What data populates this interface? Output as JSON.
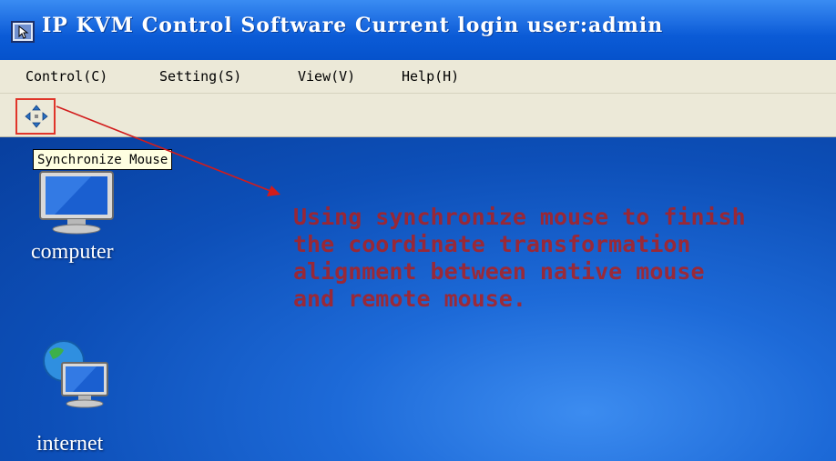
{
  "window": {
    "title": "IP KVM Control Software Current login user:admin"
  },
  "menu": {
    "items": [
      "Control(C)",
      "Setting(S)",
      "View(V)",
      "Help(H)"
    ]
  },
  "toolbar": {
    "sync_icon": "move-arrows-icon"
  },
  "tooltip": {
    "text": "Synchronize Mouse"
  },
  "annotation": {
    "lines": [
      "Using synchronize mouse to finish",
      "the coordinate transformation",
      "alignment between native mouse",
      "and remote mouse."
    ],
    "color": "#b0201f"
  },
  "desktop": {
    "icons": [
      {
        "label": "computer",
        "icon": "computer-monitor-icon"
      },
      {
        "label": "internet",
        "icon": "globe-monitor-icon"
      }
    ]
  },
  "colors": {
    "titlebar": "#0b5bd6",
    "menubar": "#ece9d8",
    "desktop": "#0d4fb8",
    "highlight": "#e0352a"
  }
}
